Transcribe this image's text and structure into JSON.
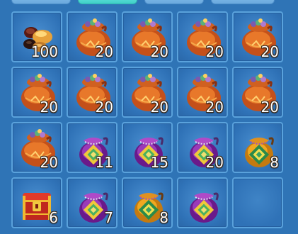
{
  "inventory": {
    "slots": [
      {
        "item": "amber-stones-icon",
        "quantity": "100"
      },
      {
        "item": "orange-treasure-bag-icon",
        "quantity": "20"
      },
      {
        "item": "orange-treasure-bag-icon",
        "quantity": "20"
      },
      {
        "item": "orange-treasure-bag-icon",
        "quantity": "20"
      },
      {
        "item": "orange-treasure-bag-icon",
        "quantity": "20"
      },
      {
        "item": "orange-treasure-bag-icon",
        "quantity": "20"
      },
      {
        "item": "orange-treasure-bag-icon",
        "quantity": "20"
      },
      {
        "item": "orange-treasure-bag-icon",
        "quantity": "20"
      },
      {
        "item": "orange-treasure-bag-icon",
        "quantity": "20"
      },
      {
        "item": "orange-treasure-bag-icon",
        "quantity": "20"
      },
      {
        "item": "orange-treasure-bag-icon",
        "quantity": "20"
      },
      {
        "item": "purple-pouch-icon",
        "quantity": "11"
      },
      {
        "item": "purple-pouch-icon",
        "quantity": "15"
      },
      {
        "item": "purple-pouch-icon",
        "quantity": "20"
      },
      {
        "item": "gold-pouch-icon",
        "quantity": "8"
      },
      {
        "item": "treasure-chest-icon",
        "quantity": "6"
      },
      {
        "item": "purple-pouch-icon",
        "quantity": "7"
      },
      {
        "item": "gold-pouch-icon",
        "quantity": "8"
      },
      {
        "item": "purple-pouch-icon",
        "quantity": ""
      },
      {
        "item": "",
        "quantity": ""
      }
    ]
  },
  "colors": {
    "background": "#2f74b6",
    "slot_border": "#5aa2dc",
    "active_tab": "#3fd0c8"
  }
}
